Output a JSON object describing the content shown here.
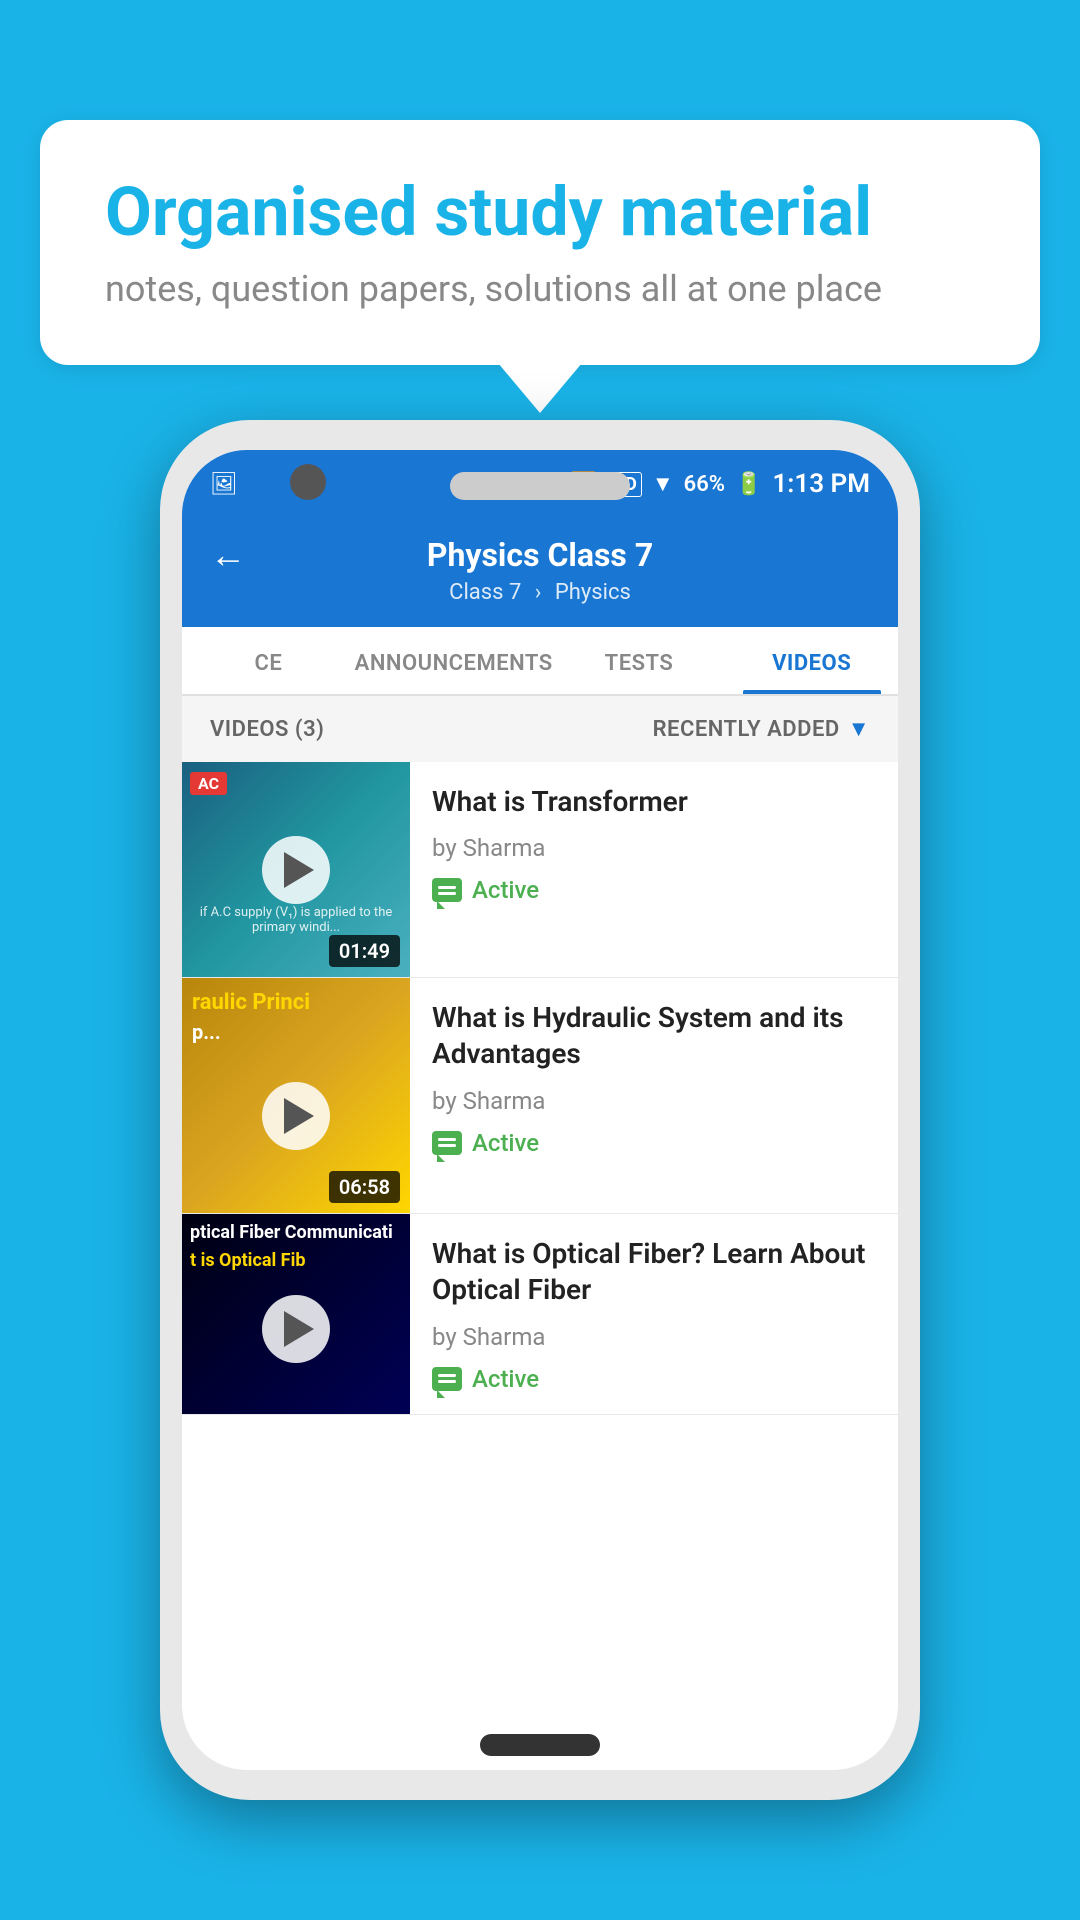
{
  "background_color": "#1ab3e8",
  "bubble": {
    "title": "Organised study material",
    "subtitle": "notes, question papers, solutions all at one place"
  },
  "status_bar": {
    "battery_percent": "66%",
    "time": "1:13 PM",
    "battery_icon": "🔋"
  },
  "app_bar": {
    "title": "Physics Class 7",
    "breadcrumb_class": "Class 7",
    "breadcrumb_subject": "Physics",
    "back_label": "←"
  },
  "tabs": [
    {
      "id": "ce",
      "label": "CE",
      "active": false
    },
    {
      "id": "announcements",
      "label": "ANNOUNCEMENTS",
      "active": false
    },
    {
      "id": "tests",
      "label": "TESTS",
      "active": false
    },
    {
      "id": "videos",
      "label": "VIDEOS",
      "active": true
    }
  ],
  "list_header": {
    "count_label": "VIDEOS (3)",
    "sort_label": "RECENTLY ADDED"
  },
  "videos": [
    {
      "title": "What is  Transformer",
      "author": "by Sharma",
      "status": "Active",
      "duration": "01:49",
      "thumb_class": "thumb-bg-1",
      "thumb_height": "thumb-height-1",
      "thumb_overlay": "if A.C supply (V₁) is applied to the primary windi...",
      "thumb_label_top": "AC"
    },
    {
      "title": "What is Hydraulic System and its Advantages",
      "author": "by Sharma",
      "status": "Active",
      "duration": "06:58",
      "thumb_class": "thumb-bg-2",
      "thumb_height": "thumb-height-2",
      "thumb_label_yellow": "raulic Princi",
      "thumb_label_white": "p..."
    },
    {
      "title": "What is Optical Fiber? Learn About Optical Fiber",
      "author": "by Sharma",
      "status": "Active",
      "duration": "",
      "thumb_class": "thumb-bg-3",
      "thumb_height": "thumb-height-3",
      "thumb_label_optical": "ptical Fiber Communicati",
      "thumb_label_optical2": "t is Optical Fib"
    }
  ]
}
